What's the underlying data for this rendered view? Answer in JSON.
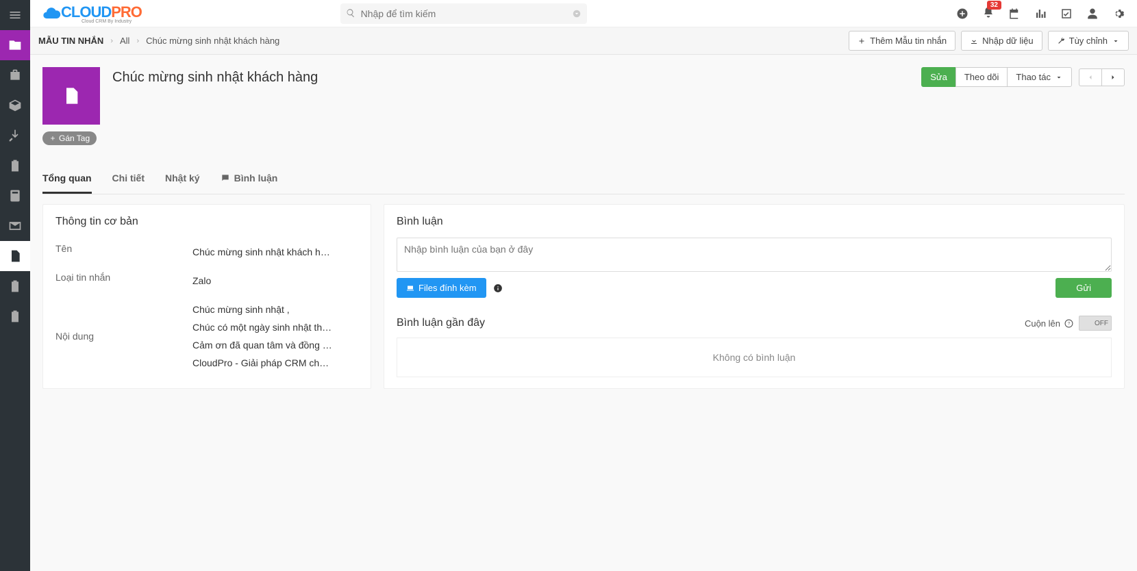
{
  "logo": {
    "part1": "CLOUD",
    "part2": "PRO",
    "tagline": "Cloud CRM By Industry"
  },
  "search": {
    "placeholder": "Nhập để tìm kiếm"
  },
  "topbar": {
    "notification_count": "32"
  },
  "breadcrumb": {
    "root": "MẪU TIN NHẮN",
    "all": "All",
    "current": "Chúc mừng sinh nhật khách hàng"
  },
  "bc_actions": {
    "add": "Thêm Mẫu tin nhắn",
    "import": "Nhập dữ liệu",
    "customize": "Tùy chỉnh"
  },
  "record": {
    "title": "Chúc mừng sinh nhật khách hàng",
    "edit": "Sửa",
    "follow": "Theo dõi",
    "actions": "Thao tác",
    "tag_btn": "Gán Tag"
  },
  "tabs": {
    "overview": "Tổng quan",
    "detail": "Chi tiết",
    "log": "Nhật ký",
    "comments": "Bình luận"
  },
  "basic_info": {
    "title": "Thông tin cơ bản",
    "name_label": "Tên",
    "name_value": "Chúc mừng sinh nhật khách h…",
    "type_label": "Loại tin nhắn",
    "type_value": "Zalo",
    "content_label": "Nội dung",
    "content_lines": {
      "l1": "Chúc mừng sinh nhật ,",
      "l2": "Chúc có một ngày sinh nhật th…",
      "l3": "Cảm ơn đã quan tâm và đồng …",
      "l4": "CloudPro - Giải pháp CRM ch…"
    }
  },
  "comments": {
    "title": "Bình luận",
    "placeholder": "Nhập bình luận của bạn ở đây",
    "attach": "Files đính kèm",
    "send": "Gửi",
    "recent_title": "Bình luận gần đây",
    "scroll_up": "Cuộn lên",
    "toggle": "OFF",
    "empty": "Không có bình luận"
  }
}
